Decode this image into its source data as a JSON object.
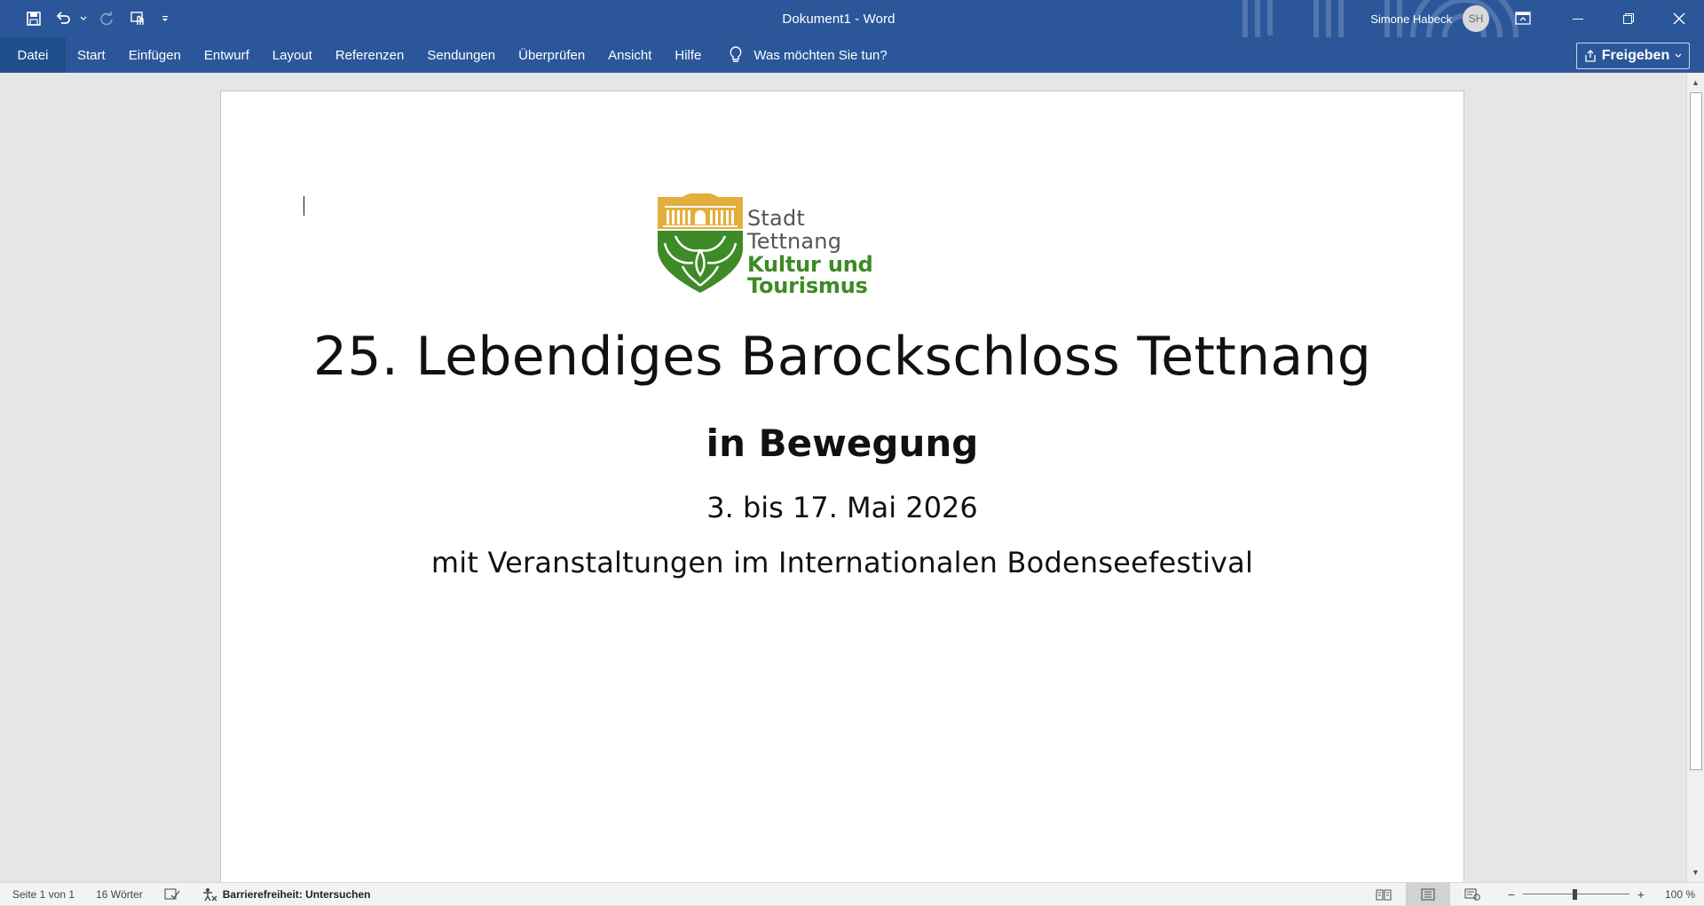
{
  "window": {
    "title": "Dokument1  -  Word",
    "user_name": "Simone Habeck",
    "user_initials": "SH"
  },
  "quick_access": {
    "icons": [
      "save-icon",
      "undo-icon",
      "undo-dropdown-icon",
      "redo-icon",
      "touch-mode-icon",
      "customize-qat-icon"
    ]
  },
  "ribbon": {
    "tabs": [
      {
        "label": "Datei"
      },
      {
        "label": "Start"
      },
      {
        "label": "Einfügen"
      },
      {
        "label": "Entwurf"
      },
      {
        "label": "Layout"
      },
      {
        "label": "Referenzen"
      },
      {
        "label": "Sendungen"
      },
      {
        "label": "Überprüfen"
      },
      {
        "label": "Ansicht"
      },
      {
        "label": "Hilfe"
      }
    ],
    "tell_me": "Was möchten Sie tun?",
    "share_label": "Freigeben"
  },
  "document": {
    "logo": {
      "line1": "Stadt",
      "line2": "Tettnang",
      "line3": "Kultur und Tourismus",
      "color_gold": "#e2ae3c",
      "color_green": "#3e8a27"
    },
    "title": "25. Lebendiges Barockschloss Tettnang",
    "subtitle": "in Bewegung",
    "date": "3. bis 17. Mai 2026",
    "info": "mit Veranstaltungen im Internationalen Bodenseefestival"
  },
  "status": {
    "page": "Seite 1 von 1",
    "words": "16 Wörter",
    "accessibility": "Barrierefreiheit: Untersuchen",
    "zoom_minus": "−",
    "zoom_plus": "+",
    "zoom": "100 %",
    "zoom_level_percent": 100
  },
  "colors": {
    "ribbon_blue": "#2b579a",
    "file_tab_blue": "#1f4e8c"
  }
}
